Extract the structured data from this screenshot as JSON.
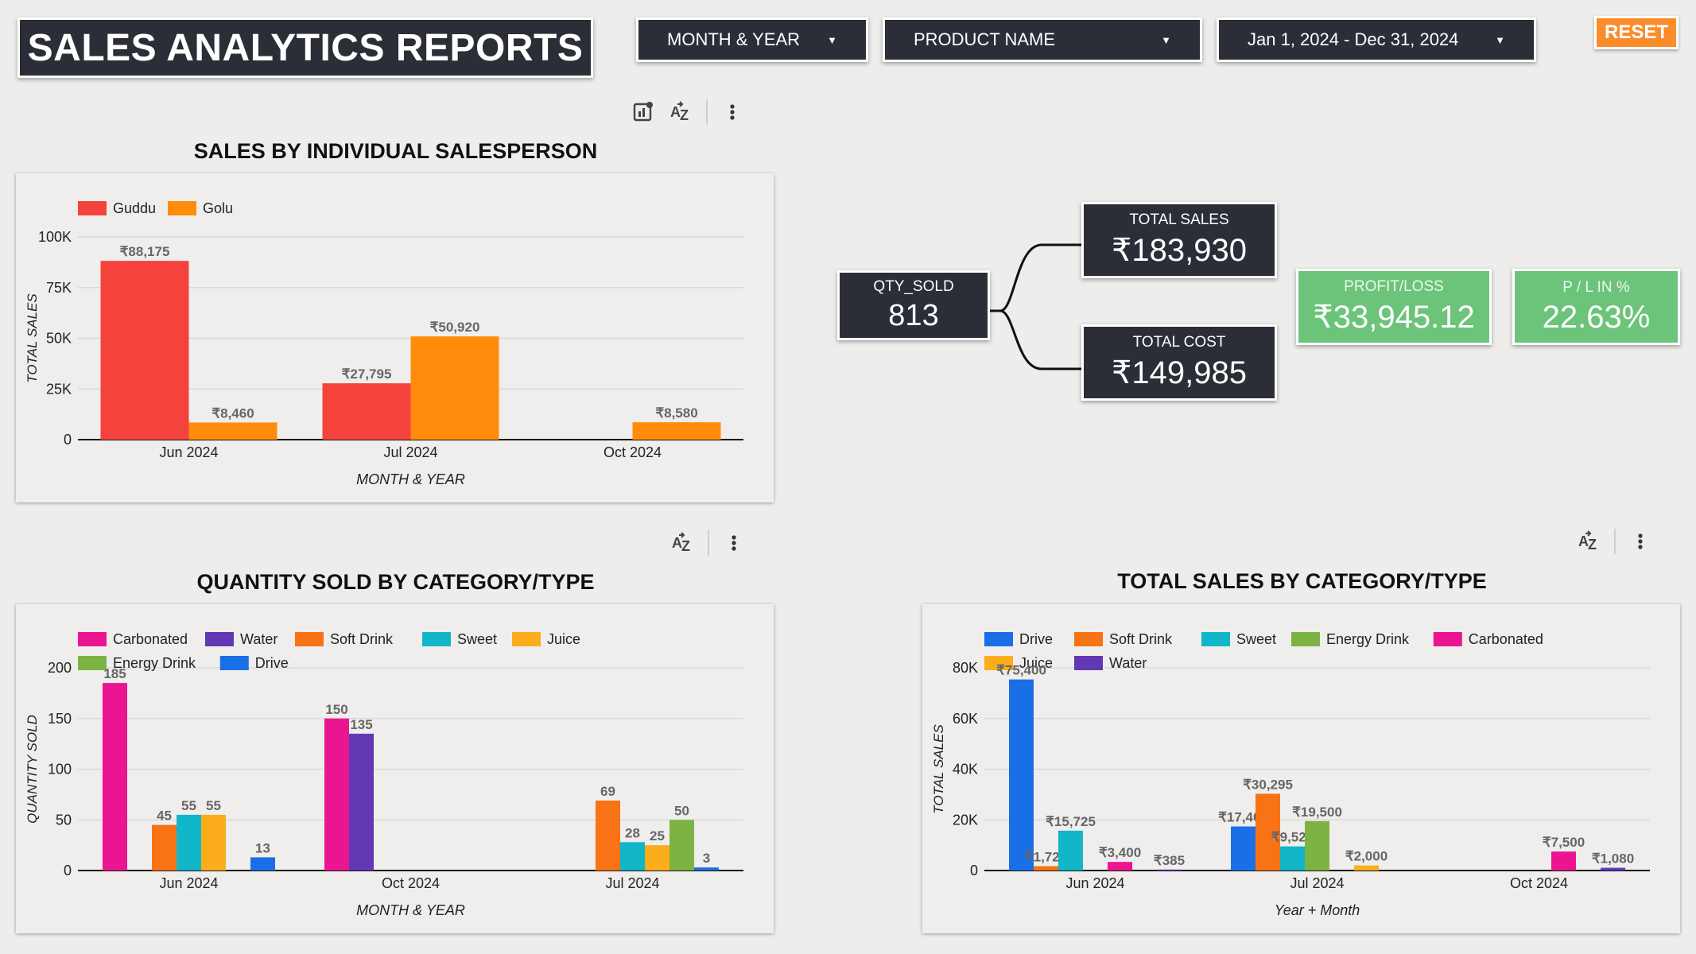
{
  "header": {
    "title": "SALES ANALYTICS REPORTS",
    "month_year_filter": "MONTH & YEAR",
    "product_filter": "PRODUCT NAME",
    "date_range": "Jan 1, 2024 - Dec 31, 2024",
    "reset_label": "RESET"
  },
  "kpis": {
    "qty_sold": {
      "label": "QTY_SOLD",
      "value": "813"
    },
    "total_sales": {
      "label": "TOTAL SALES",
      "value": "₹183,930"
    },
    "total_cost": {
      "label": "TOTAL COST",
      "value": "₹149,985"
    },
    "profit_loss": {
      "label": "PROFIT/LOSS",
      "value": "₹33,945.12"
    },
    "pl_percent": {
      "label": "P / L IN %",
      "value": "22.63%"
    }
  },
  "icons": {
    "chart_settings": "chart-settings-icon",
    "sort": "sort-az-icon",
    "more": "more-vert-icon",
    "caret": "caret-down-icon"
  },
  "chart_data": [
    {
      "id": "salesperson",
      "type": "bar",
      "title": "SALES BY INDIVIDUAL SALESPERSON",
      "xlabel": "MONTH & YEAR",
      "ylabel": "TOTAL SALES",
      "ylim": [
        0,
        100000
      ],
      "yticks": [
        0,
        25000,
        50000,
        75000,
        100000
      ],
      "ytick_labels": [
        "0",
        "25K",
        "50K",
        "75K",
        "100K"
      ],
      "categories": [
        "Jun 2024",
        "Jul 2024",
        "Oct 2024"
      ],
      "legend": "top-left",
      "grid": true,
      "series": [
        {
          "name": "Guddu",
          "color": "#f4433c",
          "values": [
            88175,
            27795,
            null
          ],
          "labels": [
            "₹88,175",
            "₹27,795",
            ""
          ]
        },
        {
          "name": "Golu",
          "color": "#ff8c0a",
          "values": [
            8460,
            50920,
            8580
          ],
          "labels": [
            "₹8,460",
            "₹50,920",
            "₹8,580"
          ]
        }
      ]
    },
    {
      "id": "qty",
      "type": "bar",
      "title": "QUANTITY SOLD BY CATEGORY/TYPE",
      "xlabel": "MONTH & YEAR",
      "ylabel": "QUANTITY SOLD",
      "ylim": [
        0,
        200
      ],
      "yticks": [
        0,
        50,
        100,
        150,
        200
      ],
      "ytick_labels": [
        "0",
        "50",
        "100",
        "150",
        "200"
      ],
      "categories": [
        "Jun 2024",
        "Oct 2024",
        "Jul 2024"
      ],
      "legend": "top-left",
      "grid": true,
      "series": [
        {
          "name": "Carbonated",
          "color": "#ec1591",
          "values": [
            185,
            150,
            null
          ],
          "labels": [
            "185",
            "150",
            ""
          ]
        },
        {
          "name": "Water",
          "color": "#6338b5",
          "values": [
            null,
            135,
            null
          ],
          "labels": [
            "",
            "135",
            ""
          ]
        },
        {
          "name": "Soft Drink",
          "color": "#f77316",
          "values": [
            45,
            null,
            69
          ],
          "labels": [
            "45",
            "",
            "69"
          ]
        },
        {
          "name": "Sweet",
          "color": "#12b6c9",
          "values": [
            55,
            null,
            28
          ],
          "labels": [
            "55",
            "",
            "28"
          ]
        },
        {
          "name": "Juice",
          "color": "#fcad1b",
          "values": [
            55,
            null,
            25
          ],
          "labels": [
            "55",
            "",
            "25"
          ]
        },
        {
          "name": "Energy Drink",
          "color": "#7cb342",
          "values": [
            null,
            null,
            50
          ],
          "labels": [
            "",
            "",
            "50"
          ]
        },
        {
          "name": "Drive",
          "color": "#1a6fe6",
          "values": [
            13,
            null,
            3
          ],
          "labels": [
            "13",
            "",
            "3"
          ]
        }
      ]
    },
    {
      "id": "totalsales",
      "type": "bar",
      "title": "TOTAL SALES BY CATEGORY/TYPE",
      "xlabel": "Year + Month",
      "ylabel": "TOTAL SALES",
      "ylim": [
        0,
        80000
      ],
      "yticks": [
        0,
        20000,
        40000,
        60000,
        80000
      ],
      "ytick_labels": [
        "0",
        "20K",
        "40K",
        "60K",
        "80K"
      ],
      "categories": [
        "Jun 2024",
        "Jul 2024",
        "Oct 2024"
      ],
      "legend": "top-left",
      "grid": true,
      "series": [
        {
          "name": "Drive",
          "color": "#1a6fe6",
          "values": [
            75400,
            17400,
            null
          ],
          "labels": [
            "₹75,400",
            "₹17,400",
            ""
          ]
        },
        {
          "name": "Soft Drink",
          "color": "#f77316",
          "values": [
            1725,
            30295,
            null
          ],
          "labels": [
            "₹1,725",
            "₹30,295",
            ""
          ]
        },
        {
          "name": "Sweet",
          "color": "#12b6c9",
          "values": [
            15725,
            9520,
            null
          ],
          "labels": [
            "₹15,725",
            "₹9,520",
            ""
          ]
        },
        {
          "name": "Energy Drink",
          "color": "#7cb342",
          "values": [
            null,
            19500,
            null
          ],
          "labels": [
            "",
            "₹19,500",
            ""
          ]
        },
        {
          "name": "Carbonated",
          "color": "#ec1591",
          "values": [
            3400,
            null,
            7500
          ],
          "labels": [
            "₹3,400",
            "",
            "₹7,500"
          ]
        },
        {
          "name": "Juice",
          "color": "#fcad1b",
          "values": [
            null,
            2000,
            null
          ],
          "labels": [
            "",
            "₹2,000",
            ""
          ]
        },
        {
          "name": "Water",
          "color": "#6338b5",
          "values": [
            385,
            null,
            1080
          ],
          "labels": [
            "₹385",
            "",
            "₹1,080"
          ]
        }
      ]
    }
  ]
}
